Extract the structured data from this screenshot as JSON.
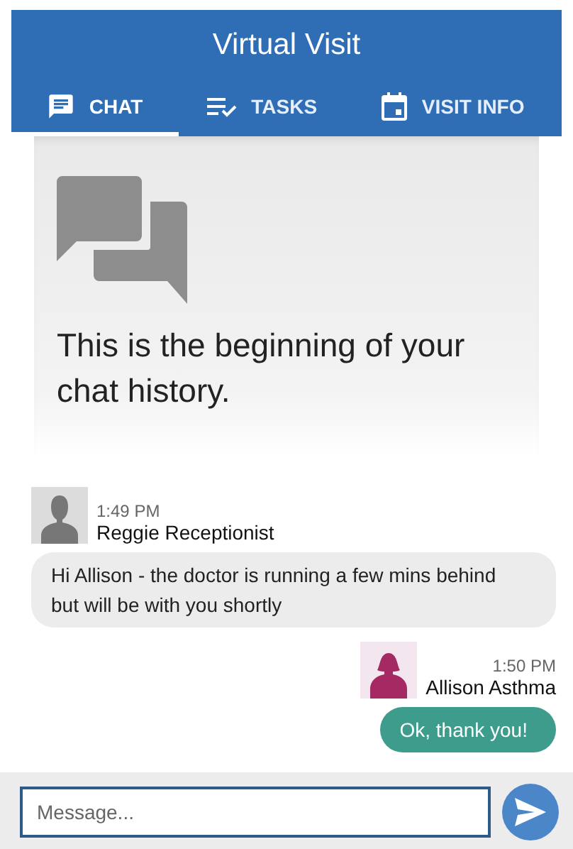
{
  "header": {
    "title": "Virtual Visit"
  },
  "tabs": [
    {
      "label": "CHAT",
      "kind": "chat",
      "selected": true
    },
    {
      "label": "TASKS",
      "kind": "tasks",
      "selected": false
    },
    {
      "label": "VISIT INFO",
      "kind": "calendar",
      "selected": false
    }
  ],
  "history_banner": {
    "text": "This is the beginning of your chat history."
  },
  "messages": [
    {
      "kind": "received",
      "time": "1:49 PM",
      "sender": "Reggie Receptionist",
      "text": "Hi Allison - the doctor is running a few mins behind but will be with you shortly"
    },
    {
      "kind": "sent",
      "time": "1:50 PM",
      "sender": "Allison Asthma",
      "text": "Ok, thank you!"
    }
  ],
  "composer": {
    "placeholder": "Message..."
  }
}
